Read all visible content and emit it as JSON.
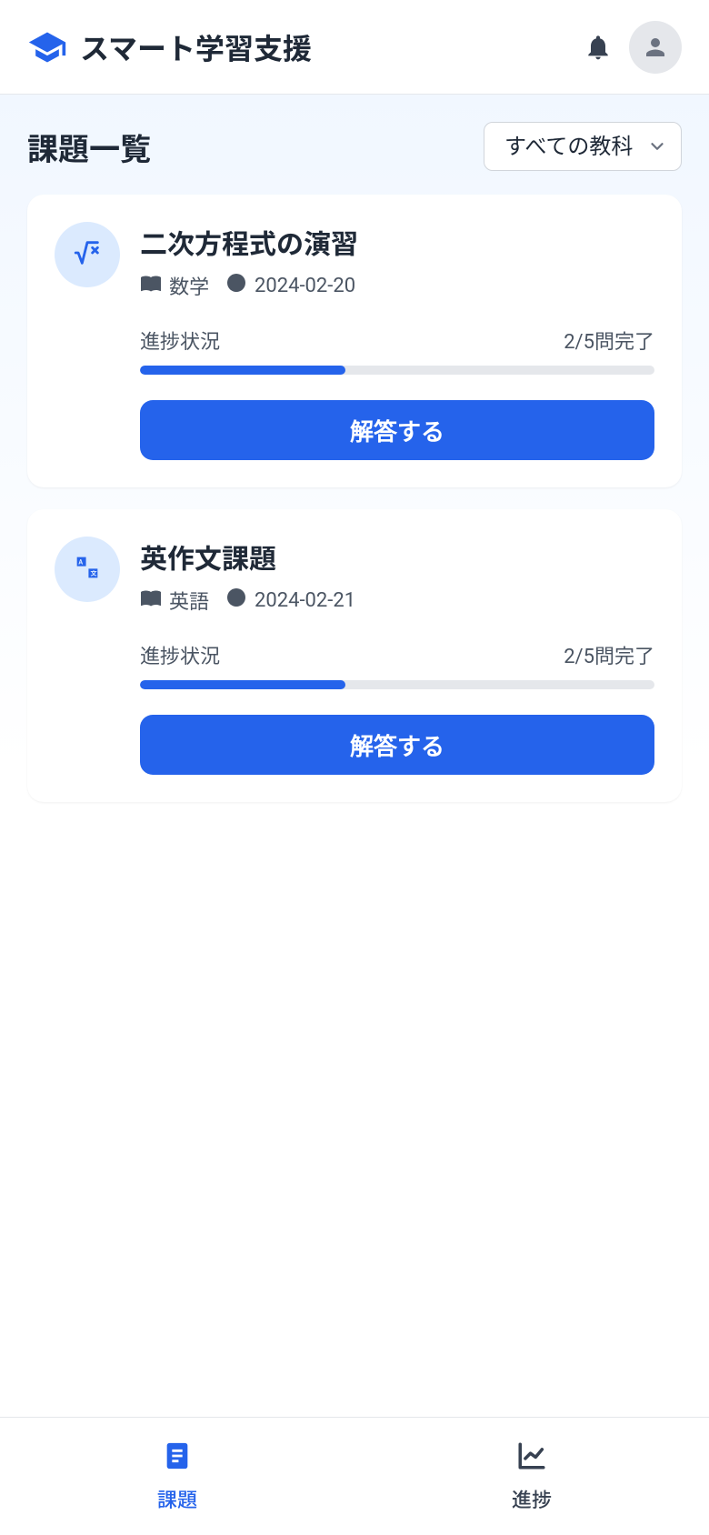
{
  "header": {
    "app_title": "スマート学習支援"
  },
  "page": {
    "title": "課題一覧",
    "filter_selected": "すべての教科"
  },
  "assignments": [
    {
      "title": "二次方程式の演習",
      "subject": "数学",
      "due_date": "2024-02-20",
      "progress_label": "進捗状況",
      "progress_count": "2/5問完了",
      "progress_percent": 40,
      "action_label": "解答する",
      "icon": "sqrt"
    },
    {
      "title": "英作文課題",
      "subject": "英語",
      "due_date": "2024-02-21",
      "progress_label": "進捗状況",
      "progress_count": "2/5問完了",
      "progress_percent": 40,
      "action_label": "解答する",
      "icon": "language"
    }
  ],
  "bottom_nav": {
    "items": [
      {
        "label": "課題",
        "active": true
      },
      {
        "label": "進捗",
        "active": false
      }
    ]
  }
}
